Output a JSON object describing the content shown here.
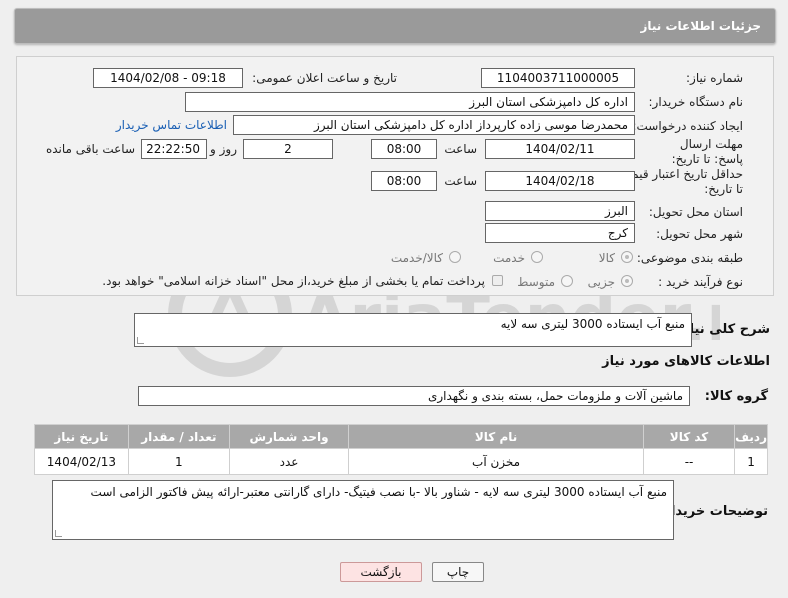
{
  "header": {
    "title": "جزئیات اطلاعات نیاز"
  },
  "form": {
    "need_number_label": "شماره نیاز:",
    "need_number": "1104003711000005",
    "announce_label": "تاریخ و ساعت اعلان عمومی:",
    "announce_value": "1404/02/08 - 09:18",
    "buyer_org_label": "نام دستگاه خریدار:",
    "buyer_org": "اداره کل دامپزشکی استان البرز",
    "requester_label": "ایجاد کننده درخواست:",
    "requester": "محمدرضا موسی زاده کارپرداز اداره کل دامپزشکی استان البرز",
    "contact_link": "اطلاعات تماس خریدار",
    "deadline_label": "مهلت ارسال پاسخ: تا تاریخ:",
    "deadline_date": "1404/02/11",
    "time_label": "ساعت",
    "deadline_time": "08:00",
    "days_value": "2",
    "days_label": "روز و",
    "remaining_time": "22:22:50",
    "remaining_label": "ساعت باقی مانده",
    "validity_label": "حداقل تاریخ اعتبار قیمت: تا تاریخ:",
    "validity_date": "1404/02/18",
    "validity_time": "08:00",
    "province_label": "استان محل تحویل:",
    "province": "البرز",
    "city_label": "شهر محل تحویل:",
    "city": "کرج",
    "category_label": "طبقه بندی موضوعی:",
    "category_options": [
      "کالا",
      "خدمت",
      "کالا/خدمت"
    ],
    "process_label": "نوع فرآیند خرید :",
    "process_options": [
      "جزیی",
      "متوسط"
    ],
    "payment_note": "پرداخت تمام یا بخشی از مبلغ خرید،از محل \"اسناد خزانه اسلامی\" خواهد بود."
  },
  "summary": {
    "label": "شرح کلی نیاز:",
    "value": "منبع آب ایستاده 3000 لیتری سه لایه"
  },
  "goods_section": {
    "title": "اطلاعات کالاهای مورد نیاز"
  },
  "goods_group": {
    "label": "گروه کالا:",
    "value": "ماشین آلات و ملزومات حمل، بسته بندی و نگهداری"
  },
  "table": {
    "headers": [
      "ردیف",
      "کد کالا",
      "نام کالا",
      "واحد شمارش",
      "تعداد / مقدار",
      "تاریخ نیاز"
    ],
    "rows": [
      [
        "1",
        "--",
        "مخزن آب",
        "عدد",
        "1",
        "1404/02/13"
      ]
    ]
  },
  "buyer_notes": {
    "label": "توضیحات خریدار:",
    "value": "منبع آب ایستاده 3000 لیتری سه لایه - شناور بالا -با نصب فیتیگ- دارای گارانتی معتبر-ارائه پیش فاکتور الزامی است"
  },
  "buttons": {
    "print": "چاپ",
    "back": "بازگشت"
  },
  "watermark": {
    "text": "AriaTender.neT"
  }
}
